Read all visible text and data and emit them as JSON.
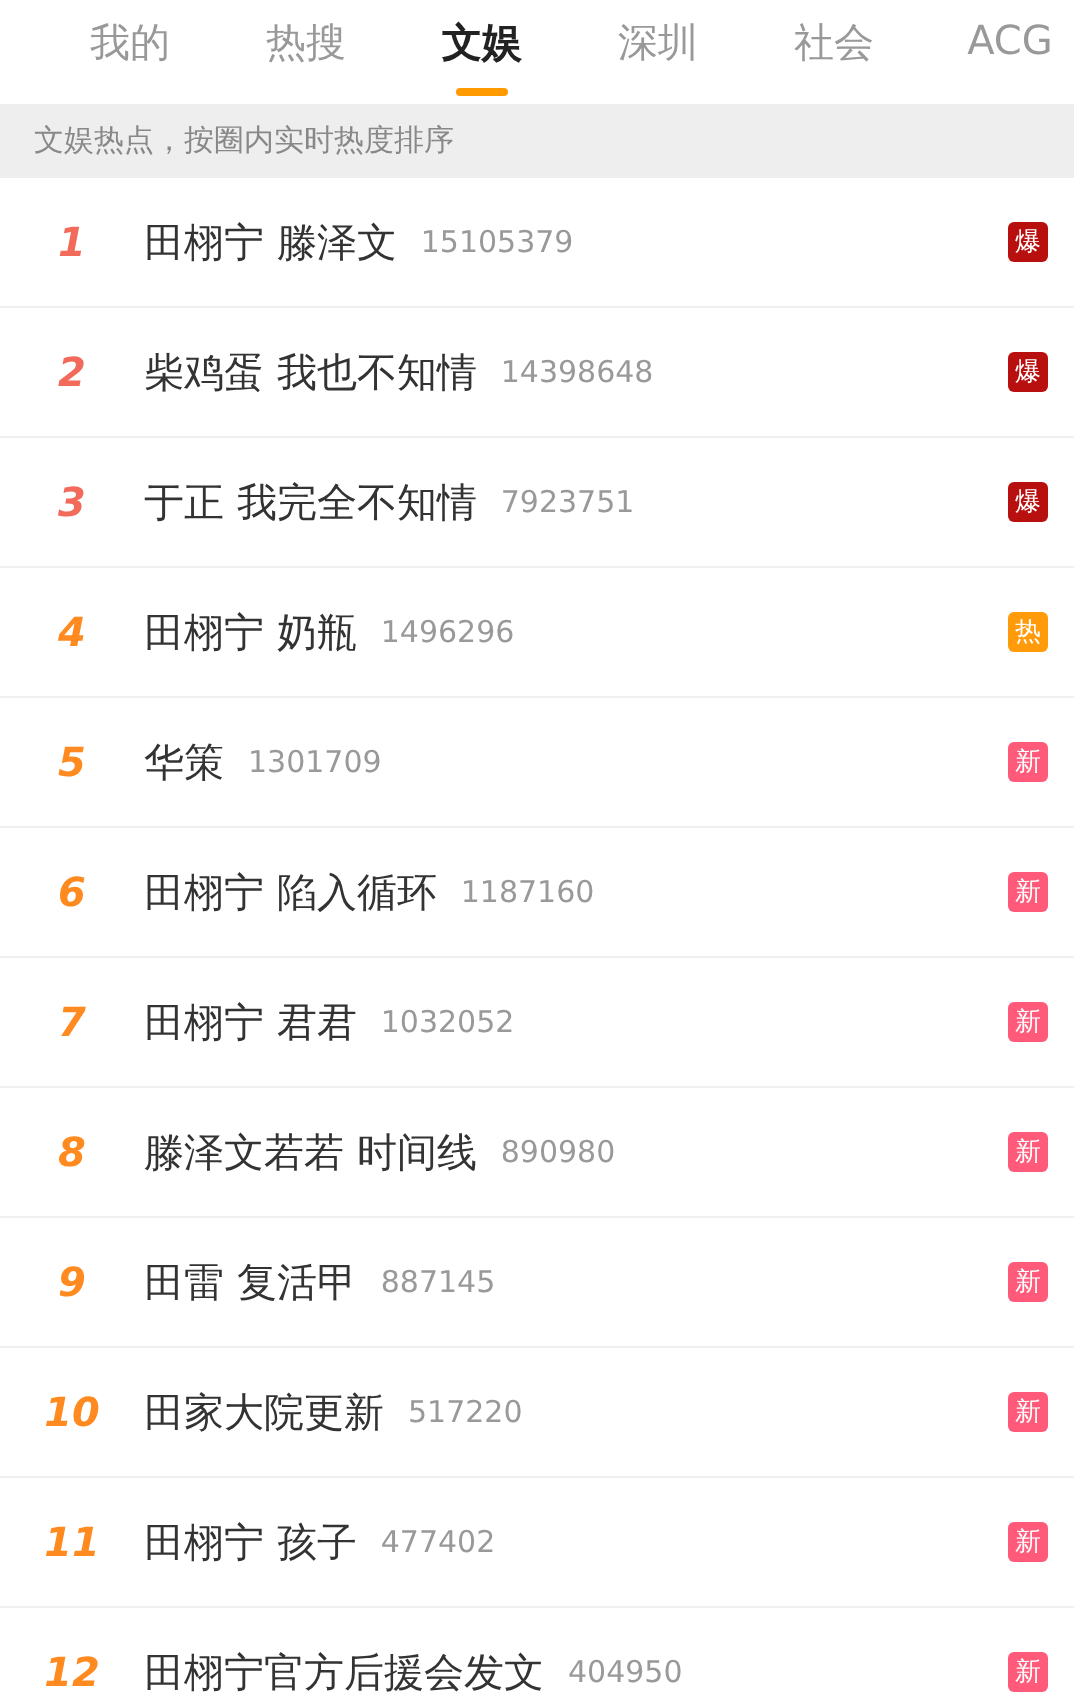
{
  "tabs": [
    {
      "label": "我的",
      "selected": false
    },
    {
      "label": "热搜",
      "selected": false
    },
    {
      "label": "文娱",
      "selected": true
    },
    {
      "label": "深圳",
      "selected": false
    },
    {
      "label": "社会",
      "selected": false
    },
    {
      "label": "ACG",
      "selected": false
    }
  ],
  "notice": "文娱热点，按圈内实时热度排序",
  "items": [
    {
      "rank": "1",
      "color": "#f26a5a",
      "title": "田栩宁 滕泽文",
      "count": "15105379",
      "badge": {
        "kind": "boom",
        "label": "爆"
      }
    },
    {
      "rank": "2",
      "color": "#f26a5a",
      "title": "柴鸡蛋 我也不知情",
      "count": "14398648",
      "badge": {
        "kind": "boom",
        "label": "爆"
      }
    },
    {
      "rank": "3",
      "color": "#f26a5a",
      "title": "于正 我完全不知情",
      "count": "7923751",
      "badge": {
        "kind": "boom",
        "label": "爆"
      }
    },
    {
      "rank": "4",
      "color": "#ff8a1f",
      "title": "田栩宁 奶瓶",
      "count": "1496296",
      "badge": {
        "kind": "hot",
        "label": "热"
      }
    },
    {
      "rank": "5",
      "color": "#ff8a1f",
      "title": "华策",
      "count": "1301709",
      "badge": {
        "kind": "new",
        "label": "新"
      }
    },
    {
      "rank": "6",
      "color": "#ff8a1f",
      "title": "田栩宁 陷入循环",
      "count": "1187160",
      "badge": {
        "kind": "new",
        "label": "新"
      }
    },
    {
      "rank": "7",
      "color": "#ff8a1f",
      "title": "田栩宁 君君",
      "count": "1032052",
      "badge": {
        "kind": "new",
        "label": "新"
      }
    },
    {
      "rank": "8",
      "color": "#ff8a1f",
      "title": "滕泽文若若 时间线",
      "count": "890980",
      "badge": {
        "kind": "new",
        "label": "新"
      }
    },
    {
      "rank": "9",
      "color": "#ff8a1f",
      "title": "田雷 复活甲",
      "count": "887145",
      "badge": {
        "kind": "new",
        "label": "新"
      }
    },
    {
      "rank": "10",
      "color": "#ff8a1f",
      "title": "田家大院更新",
      "count": "517220",
      "badge": {
        "kind": "new",
        "label": "新"
      }
    },
    {
      "rank": "11",
      "color": "#ff8a1f",
      "title": "田栩宁 孩子",
      "count": "477402",
      "badge": {
        "kind": "new",
        "label": "新"
      }
    },
    {
      "rank": "12",
      "color": "#ff8a1f",
      "title": "田栩宁官方后援会发文",
      "count": "404950",
      "badge": {
        "kind": "new",
        "label": "新"
      }
    }
  ]
}
